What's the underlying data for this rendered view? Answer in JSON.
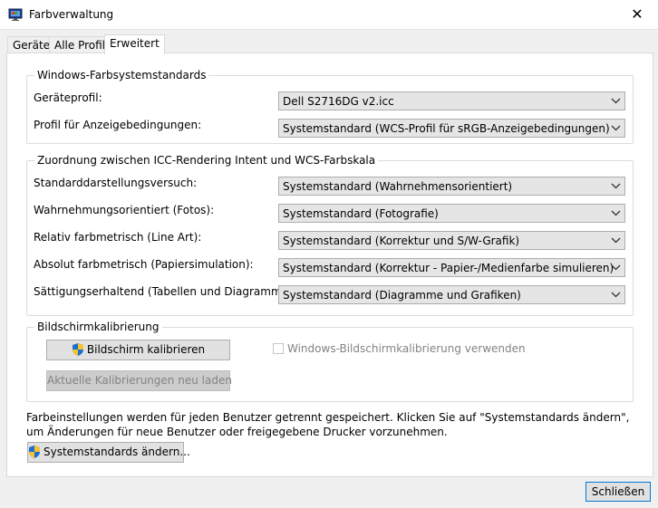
{
  "window": {
    "title": "Farbverwaltung",
    "close_glyph": "✕"
  },
  "tabs": [
    {
      "label": "Geräte",
      "active": false
    },
    {
      "label": "Alle Profile",
      "active": false
    },
    {
      "label": "Erweitert",
      "active": true
    }
  ],
  "wcs_defaults": {
    "legend": "Windows-Farbsystemstandards",
    "device_profile_label": "Geräteprofil:",
    "device_profile_value": "Dell S2716DG v2.icc",
    "viewing_conditions_label": "Profil für Anzeigebedingungen:",
    "viewing_conditions_value": "Systemstandard (WCS-Profil für sRGB-Anzeigebedingungen)"
  },
  "rendering_intent": {
    "legend": "Zuordnung zwischen ICC-Rendering Intent und WCS-Farbskala",
    "rows": [
      {
        "label": "Standarddarstellungsversuch:",
        "value": "Systemstandard (Wahrnehmensorientiert)"
      },
      {
        "label": "Wahrnehmungsorientiert (Fotos):",
        "value": "Systemstandard (Fotografie)"
      },
      {
        "label": "Relativ farbmetrisch (Line Art):",
        "value": "Systemstandard (Korrektur und S/W-Grafik)"
      },
      {
        "label": "Absolut farbmetrisch (Papiersimulation):",
        "value": "Systemstandard (Korrektur - Papier-/Medienfarbe simulieren)"
      },
      {
        "label": "Sättigungserhaltend (Tabellen und Diagramme):",
        "value": "Systemstandard (Diagramme und Grafiken)"
      }
    ]
  },
  "calibration": {
    "legend": "Bildschirmkalibrierung",
    "calibrate_button": "Bildschirm kalibrieren",
    "use_windows_calibration_label": "Windows-Bildschirmkalibrierung verwenden",
    "use_windows_calibration_checked": false,
    "reload_button": "Aktuelle Kalibrierungen neu laden"
  },
  "info": {
    "text": "Farbeinstellungen werden für jeden Benutzer getrennt gespeichert. Klicken Sie auf \"Systemstandards ändern\", um Änderungen für neue Benutzer oder freigegebene Drucker vorzunehmen."
  },
  "change_defaults_button": "Systemstandards ändern...",
  "close_button": "Schließen",
  "colors": {
    "accent_blue": "#0078d7",
    "panel_bg": "#ffffff",
    "window_bg": "#f0f0f0"
  },
  "icons": {
    "app": "color-management-icon",
    "shield": "uac-shield-icon",
    "dropdown": "chevron-down-icon"
  }
}
